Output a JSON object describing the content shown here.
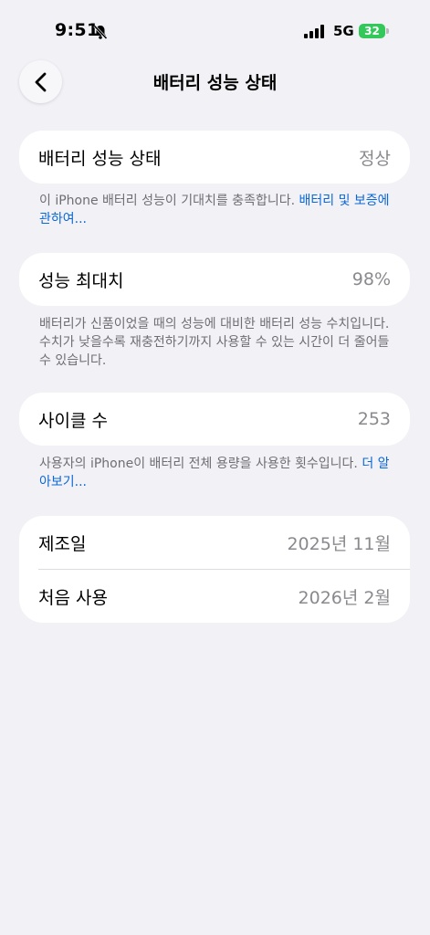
{
  "status_bar": {
    "time": "9:51",
    "network": "5G",
    "battery_level": "32"
  },
  "header": {
    "title": "배터리 성능 상태"
  },
  "battery_health": {
    "label": "배터리 성능 상태",
    "value": "정상",
    "note_text": "이 iPhone 배터리 성능이 기대치를 충족합니다. ",
    "note_link": "배터리 및 보증에 관하여..."
  },
  "max_capacity": {
    "label": "성능 최대치",
    "value": "98%",
    "note_text": "배터리가 신품이었을 때의 성능에 대비한 배터리 성능 수치입니다. 수치가 낮을수록 재충전하기까지 사용할 수 있는 시간이 더 줄어들 수 있습니다."
  },
  "cycle_count": {
    "label": "사이클 수",
    "value": "253",
    "note_text": "사용자의 iPhone이 배터리 전체 용량을 사용한 횟수입니다. ",
    "note_link": "더 알아보기..."
  },
  "dates": {
    "manufacture_label": "제조일",
    "manufacture_value": "2025년 11월",
    "first_use_label": "처음 사용",
    "first_use_value": "2026년 2월"
  },
  "colors": {
    "background": "#f2f1f6",
    "link": "#0a67d6",
    "battery": "#34c759"
  }
}
